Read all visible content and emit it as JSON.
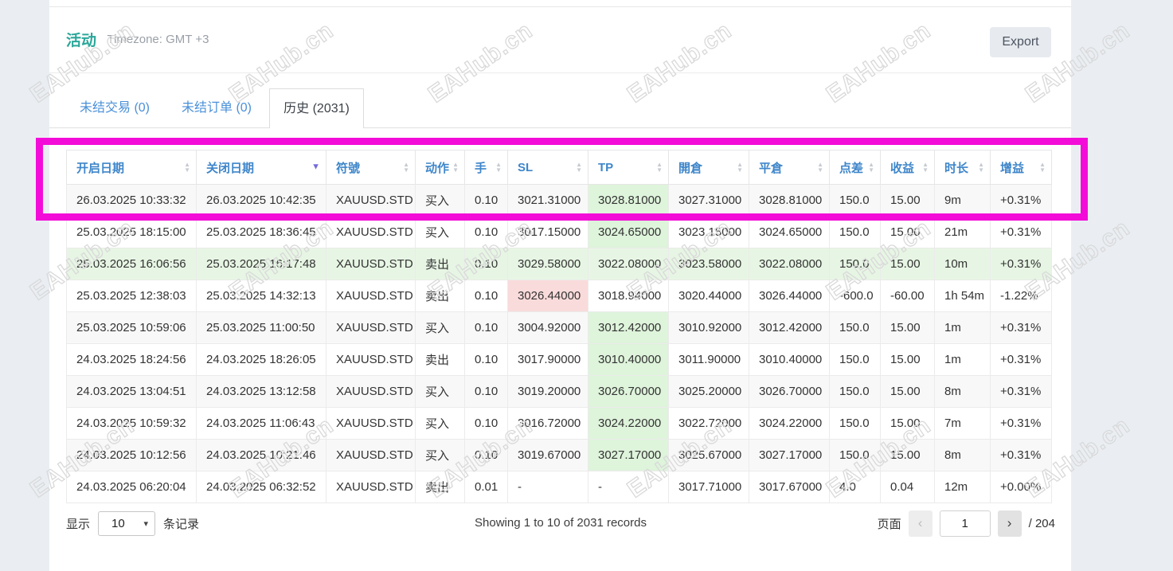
{
  "header": {
    "title": "活动",
    "timezone": "Timezone: GMT +3",
    "export_label": "Export"
  },
  "tabs": [
    {
      "label": "未结交易 (0)",
      "active": false
    },
    {
      "label": "未结订单 (0)",
      "active": false
    },
    {
      "label": "历史 (2031)",
      "active": true
    }
  ],
  "watermark_text": "EAHub.cn",
  "table": {
    "columns": [
      {
        "label": "开启日期",
        "sort": "both"
      },
      {
        "label": "关闭日期",
        "sort": "desc"
      },
      {
        "label": "符號",
        "sort": "both"
      },
      {
        "label": "动作",
        "sort": "both"
      },
      {
        "label": "手",
        "sort": "both"
      },
      {
        "label": "SL",
        "sort": "both"
      },
      {
        "label": "TP",
        "sort": "both"
      },
      {
        "label": "開倉",
        "sort": "both"
      },
      {
        "label": "平倉",
        "sort": "both"
      },
      {
        "label": "点差",
        "sort": "both"
      },
      {
        "label": "收益",
        "sort": "both"
      },
      {
        "label": "时长",
        "sort": "both"
      },
      {
        "label": "增益",
        "sort": "both"
      }
    ],
    "rows": [
      {
        "cells": [
          "26.03.2025 10:33:32",
          "26.03.2025 10:42:35",
          "XAUUSD.STD",
          "买入",
          "0.10",
          "3021.31000",
          "3028.81000",
          "3027.31000",
          "3028.81000",
          "150.0",
          "15.00",
          "9m",
          "+0.31%"
        ],
        "highlight": "tp"
      },
      {
        "cells": [
          "25.03.2025 18:15:00",
          "25.03.2025 18:36:45",
          "XAUUSD.STD",
          "买入",
          "0.10",
          "3017.15000",
          "3024.65000",
          "3023.15000",
          "3024.65000",
          "150.0",
          "15.00",
          "21m",
          "+0.31%"
        ],
        "highlight": "tp"
      },
      {
        "cells": [
          "25.03.2025 16:06:56",
          "25.03.2025 16:17:48",
          "XAUUSD.STD",
          "卖出",
          "0.10",
          "3029.58000",
          "3022.08000",
          "3023.58000",
          "3022.08000",
          "150.0",
          "15.00",
          "10m",
          "+0.31%"
        ],
        "highlight": "row"
      },
      {
        "cells": [
          "25.03.2025 12:38:03",
          "25.03.2025 14:32:13",
          "XAUUSD.STD",
          "卖出",
          "0.10",
          "3026.44000",
          "3018.94000",
          "3020.44000",
          "3026.44000",
          "-600.0",
          "-60.00",
          "1h 54m",
          "-1.22%"
        ],
        "highlight": "sl"
      },
      {
        "cells": [
          "25.03.2025 10:59:06",
          "25.03.2025 11:00:50",
          "XAUUSD.STD",
          "买入",
          "0.10",
          "3004.92000",
          "3012.42000",
          "3010.92000",
          "3012.42000",
          "150.0",
          "15.00",
          "1m",
          "+0.31%"
        ],
        "highlight": "tp"
      },
      {
        "cells": [
          "24.03.2025 18:24:56",
          "24.03.2025 18:26:05",
          "XAUUSD.STD",
          "卖出",
          "0.10",
          "3017.90000",
          "3010.40000",
          "3011.90000",
          "3010.40000",
          "150.0",
          "15.00",
          "1m",
          "+0.31%"
        ],
        "highlight": "tp"
      },
      {
        "cells": [
          "24.03.2025 13:04:51",
          "24.03.2025 13:12:58",
          "XAUUSD.STD",
          "买入",
          "0.10",
          "3019.20000",
          "3026.70000",
          "3025.20000",
          "3026.70000",
          "150.0",
          "15.00",
          "8m",
          "+0.31%"
        ],
        "highlight": "tp"
      },
      {
        "cells": [
          "24.03.2025 10:59:32",
          "24.03.2025 11:06:43",
          "XAUUSD.STD",
          "买入",
          "0.10",
          "3016.72000",
          "3024.22000",
          "3022.72000",
          "3024.22000",
          "150.0",
          "15.00",
          "7m",
          "+0.31%"
        ],
        "highlight": "tp"
      },
      {
        "cells": [
          "24.03.2025 10:12:56",
          "24.03.2025 10:21:46",
          "XAUUSD.STD",
          "买入",
          "0.10",
          "3019.67000",
          "3027.17000",
          "3025.67000",
          "3027.17000",
          "150.0",
          "15.00",
          "8m",
          "+0.31%"
        ],
        "highlight": "tp"
      },
      {
        "cells": [
          "24.03.2025 06:20:04",
          "24.03.2025 06:32:52",
          "XAUUSD.STD",
          "卖出",
          "0.01",
          "-",
          "-",
          "3017.71000",
          "3017.67000",
          "4.0",
          "0.04",
          "12m",
          "+0.00%"
        ],
        "highlight": ""
      }
    ]
  },
  "footer": {
    "show_label": "显示",
    "page_size": "10",
    "records_label": "条记录",
    "showing_text": "Showing 1 to 10 of 2031 records",
    "page_label": "页面",
    "prev_icon": "‹",
    "next_icon": "›",
    "current_page": "1",
    "total_pages_text": "/ 204"
  }
}
